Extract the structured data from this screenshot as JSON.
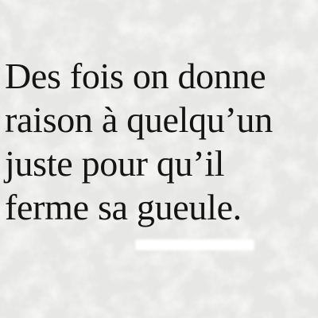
{
  "quote": {
    "lines": [
      "Des fois on donne",
      "raison à quelqu’un",
      "juste pour qu’il",
      "ferme sa gueule."
    ]
  },
  "colors": {
    "background": "#ededeb",
    "text": "#141414",
    "texture": "#ffffff"
  }
}
